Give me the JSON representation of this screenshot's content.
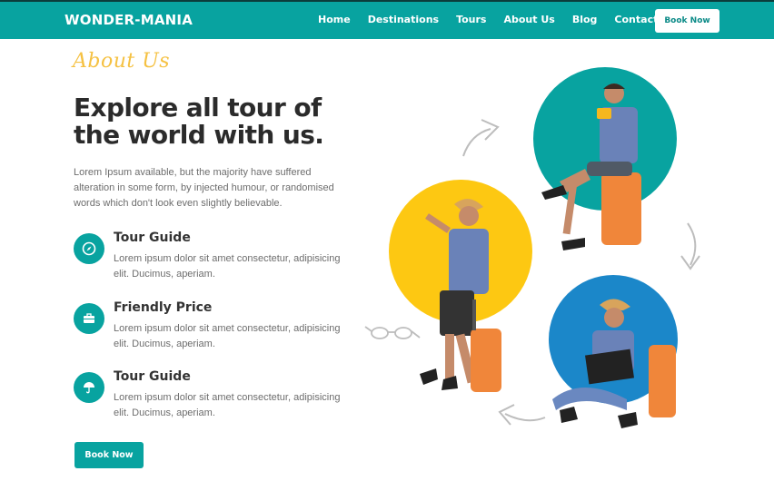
{
  "header": {
    "brand": "WONDER-MANIA",
    "nav": [
      "Home",
      "Destinations",
      "Tours",
      "About Us",
      "Blog",
      "Contact Us"
    ],
    "cta": "Book Now"
  },
  "about": {
    "script_label": "About Us",
    "headline": "Explore all tour of the world with us.",
    "intro": "Lorem Ipsum available, but the majority have suffered alteration in some form, by injected humour, or randomised words which don't look even slightly believable."
  },
  "features": [
    {
      "title": "Tour Guide",
      "text": "Lorem ipsum dolor sit amet consectetur, adipisicing elit. Ducimus, aperiam.",
      "icon": "compass-icon"
    },
    {
      "title": "Friendly Price",
      "text": "Lorem ipsum dolor sit amet consectetur, adipisicing elit. Ducimus, aperiam.",
      "icon": "briefcase-icon"
    },
    {
      "title": "Tour Guide",
      "text": "Lorem ipsum dolor sit amet consectetur, adipisicing elit. Ducimus, aperiam.",
      "icon": "umbrella-icon"
    }
  ],
  "cta_button": "Book Now",
  "colors": {
    "primary": "#08a3a0",
    "accent": "#f5c142",
    "blue": "#1b87c9"
  }
}
